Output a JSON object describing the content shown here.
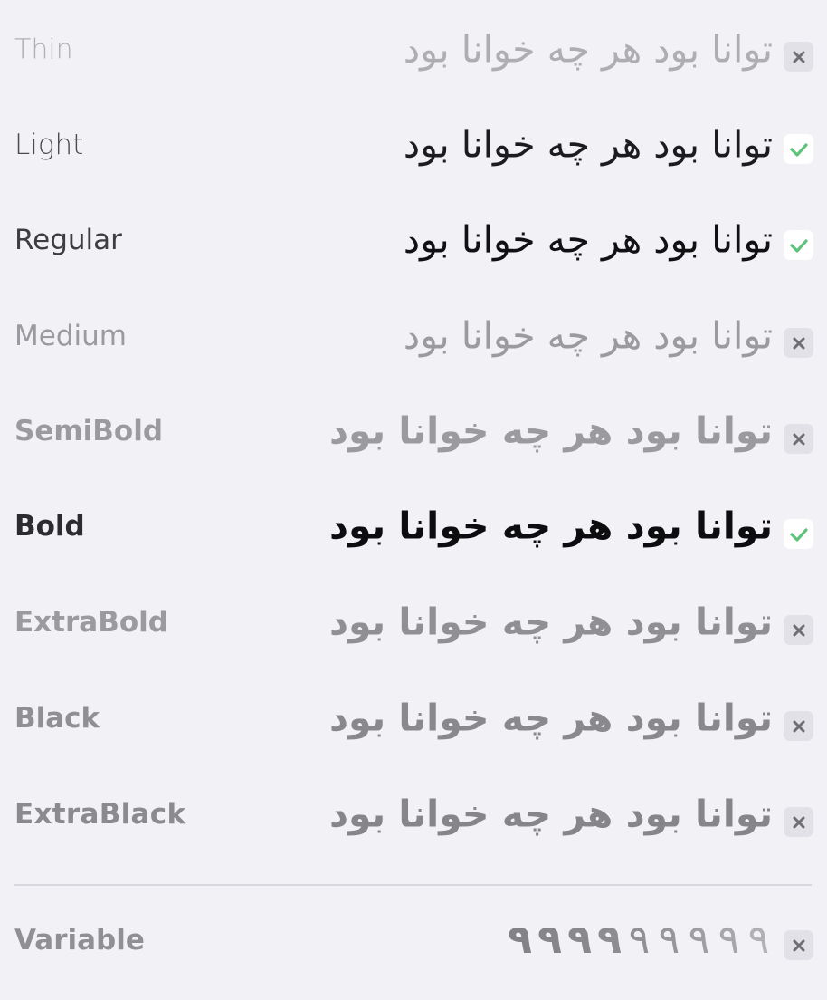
{
  "sample_text": "توانا بود هر چه خوانا بود",
  "weights": [
    {
      "label": "Thin",
      "status": "unsupported"
    },
    {
      "label": "Light",
      "status": "supported"
    },
    {
      "label": "Regular",
      "status": "supported"
    },
    {
      "label": "Medium",
      "status": "unsupported"
    },
    {
      "label": "SemiBold",
      "status": "unsupported"
    },
    {
      "label": "Bold",
      "status": "supported"
    },
    {
      "label": "ExtraBold",
      "status": "unsupported"
    },
    {
      "label": "Black",
      "status": "unsupported"
    },
    {
      "label": "ExtraBlack",
      "status": "unsupported"
    }
  ],
  "variable": {
    "label": "Variable",
    "glyphs": [
      "٩",
      "٩",
      "٩",
      "٩",
      "٩",
      "٩",
      "٩",
      "٩",
      "٩"
    ],
    "status": "unsupported"
  },
  "colors": {
    "background": "#f2f1f6",
    "check": "#5ec27a",
    "cross": "#6e6e73",
    "dim_text": "#9a9a9f",
    "active_text": "#161618"
  },
  "icons": {
    "supported": "checkmark-icon",
    "unsupported": "close-icon"
  }
}
